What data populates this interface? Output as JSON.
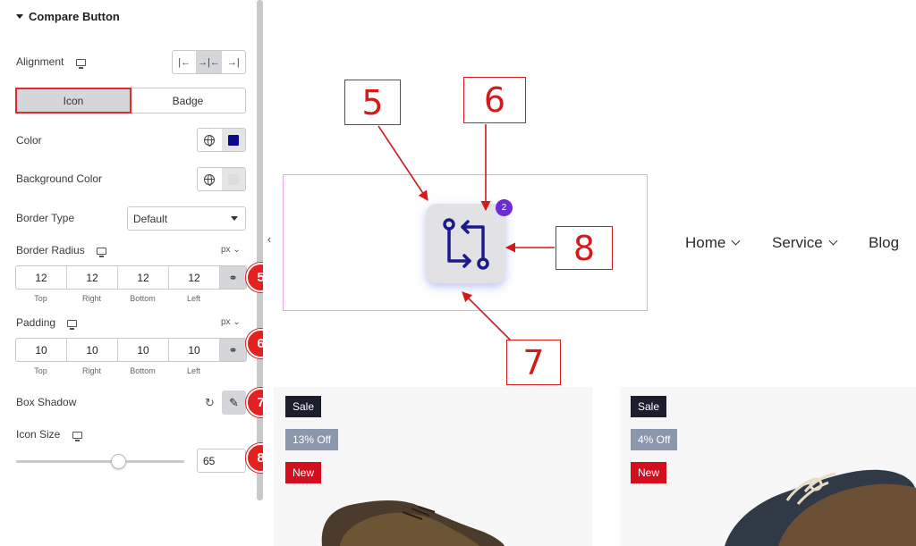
{
  "panel": {
    "section_title": "Compare Button",
    "alignment_label": "Alignment",
    "alignment_options": [
      "left",
      "center",
      "right"
    ],
    "tabs": [
      {
        "label": "Icon",
        "active": true
      },
      {
        "label": "Badge",
        "active": false
      }
    ],
    "color_label": "Color",
    "color_value": "#0b0b8a",
    "background_color_label": "Background Color",
    "border_type_label": "Border Type",
    "border_type_value": "Default",
    "border_radius_label": "Border Radius",
    "border_radius_unit": "px",
    "border_radius_values": [
      "12",
      "12",
      "12",
      "12"
    ],
    "padding_label": "Padding",
    "padding_unit": "px",
    "padding_values": [
      "10",
      "10",
      "10",
      "10"
    ],
    "dimension_labels": [
      "Top",
      "Right",
      "Bottom",
      "Left"
    ],
    "box_shadow_label": "Box Shadow",
    "icon_size_label": "Icon Size",
    "icon_size_value": "65",
    "icon_size_fraction": 0.6
  },
  "callouts": [
    "5",
    "6",
    "7",
    "8"
  ],
  "annotations": [
    "5",
    "6",
    "7",
    "8"
  ],
  "preview": {
    "badge_count": "2",
    "nav": [
      {
        "label": "Home",
        "has_dropdown": true
      },
      {
        "label": "Service",
        "has_dropdown": true
      },
      {
        "label": "Blog",
        "has_dropdown": false
      }
    ],
    "cards": [
      {
        "sale": "Sale",
        "discount": "13% Off",
        "new": "New"
      },
      {
        "sale": "Sale",
        "discount": "4% Off",
        "new": "New"
      }
    ]
  },
  "colors": {
    "accent_red": "#e42020",
    "badge_purple": "#6b2bd8",
    "icon_navy": "#1a1a8c",
    "widget_outline": "#e8a6ee"
  }
}
